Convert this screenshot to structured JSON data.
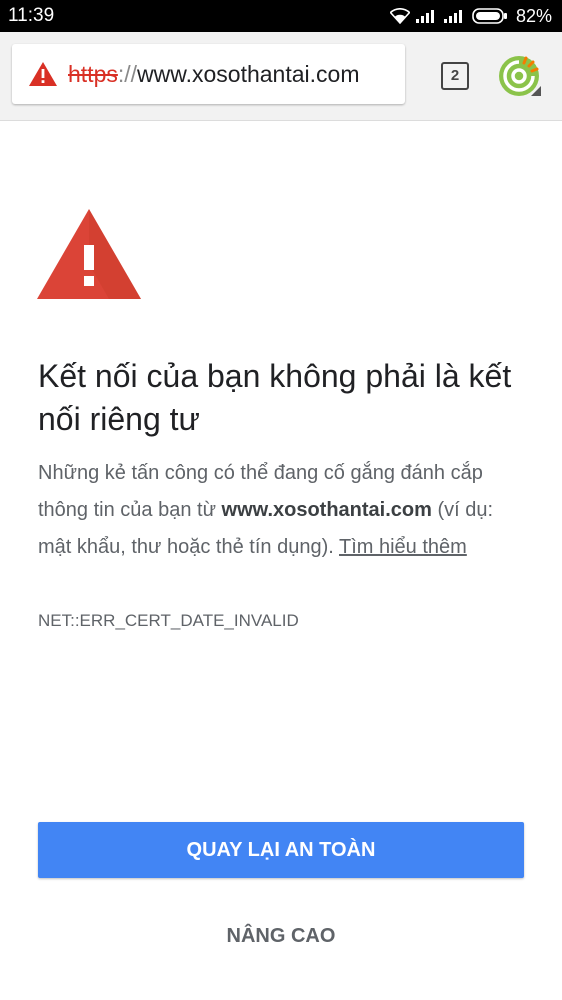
{
  "status_bar": {
    "time": "11:39",
    "battery_percent": "82%",
    "icons": [
      "wifi-icon",
      "signal-icon",
      "signal-icon",
      "battery-icon"
    ]
  },
  "toolbar": {
    "url_scheme": "https",
    "url_separator": "://",
    "url_host": "www.xosothantai.com",
    "security_icon": "warning-triangle-icon",
    "tab_count": "2",
    "menu_icon": "browser-logo-icon"
  },
  "interstitial": {
    "warning_icon": "warning-triangle-icon",
    "heading": "Kết nối của bạn không phải là kết nối riêng tư",
    "body_before": "Những kẻ tấn công có thể đang cố gắng đánh cắp thông tin của bạn từ ",
    "body_domain": "www.xosothantai.com",
    "body_after": " (ví dụ: mật khẩu, thư hoặc thẻ tín dụng). ",
    "learn_more": "Tìm hiểu thêm",
    "error_code": "NET::ERR_CERT_DATE_INVALID",
    "primary_button": "QUAY LẠI AN TOÀN",
    "secondary_button": "NÂNG CAO"
  },
  "colors": {
    "danger_red": "#db4437",
    "primary_blue": "#4285f4",
    "toolbar_bg": "#f2f2f2",
    "status_bar_bg": "#000000"
  }
}
